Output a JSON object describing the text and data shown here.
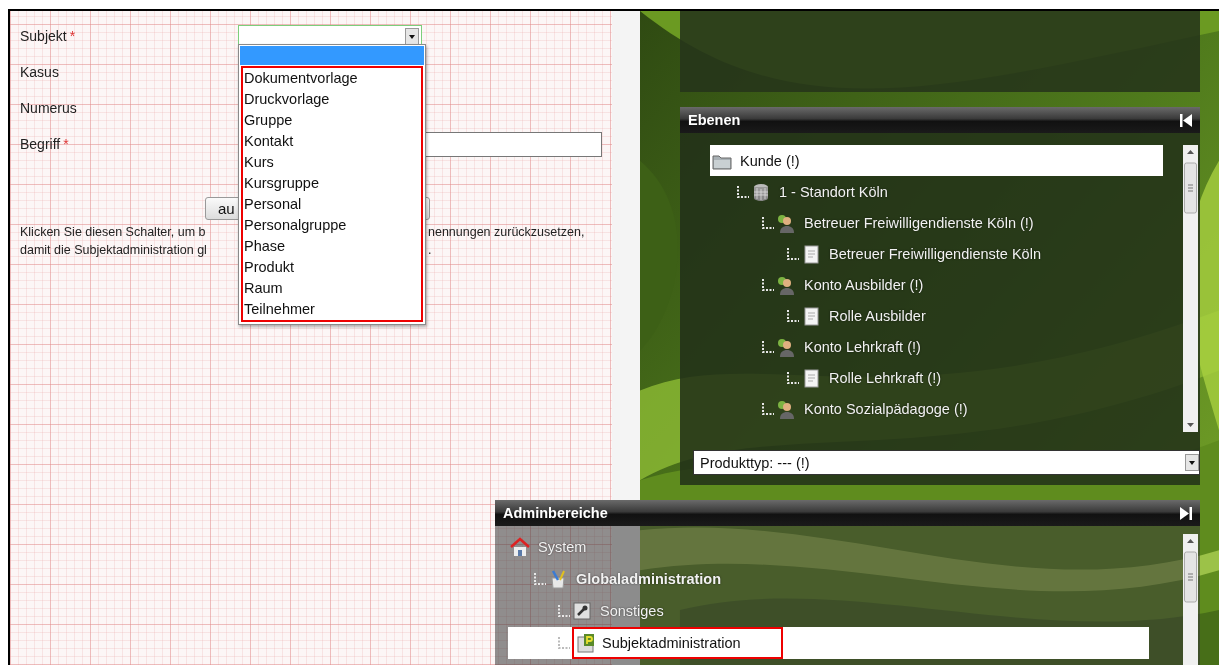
{
  "form": {
    "fields": [
      {
        "label": "Subjekt",
        "required_mark": "*",
        "kind": "select"
      },
      {
        "label": "Kasus",
        "kind": "label"
      },
      {
        "label": "Numerus",
        "kind": "label"
      },
      {
        "label": "Begriff",
        "required_mark": "*",
        "kind": "text"
      }
    ],
    "dropdown": {
      "open": true,
      "highlight_frame": true,
      "options": [
        "Dokumentvorlage",
        "Druckvorlage",
        "Gruppe",
        "Kontakt",
        "Kurs",
        "Kursgruppe",
        "Personal",
        "Personalgruppe",
        "Phase",
        "Produkt",
        "Raum",
        "Teilnehmer"
      ]
    },
    "reset_button": {
      "label": "au"
    },
    "help_text": [
      [
        "Klicken Sie diesen Schalter, um b",
        "nennungen zurückzusetzen,"
      ],
      [
        "damit die Subjektadministration gl",
        "."
      ]
    ]
  },
  "ebenen_panel": {
    "title": "Ebenen",
    "tree": [
      {
        "label": "Kunde (!)",
        "kind": "folder",
        "selected": true,
        "bold": false,
        "marked": false,
        "children": [
          {
            "label": "1 - Standort Köln",
            "kind": "site",
            "selected": false,
            "bold": false,
            "marked": false,
            "children": [
              {
                "label": "Betreuer Freiwilligendienste Köln (!)",
                "kind": "account",
                "selected": false,
                "bold": false,
                "marked": false,
                "children": [
                  {
                    "label": "Betreuer Freiwilligendienste Köln",
                    "kind": "role",
                    "selected": false,
                    "bold": false,
                    "marked": false
                  }
                ]
              },
              {
                "label": "Konto Ausbilder (!)",
                "kind": "account",
                "selected": false,
                "bold": false,
                "marked": false,
                "children": [
                  {
                    "label": "Rolle Ausbilder",
                    "kind": "role",
                    "selected": false,
                    "bold": false,
                    "marked": false
                  }
                ]
              },
              {
                "label": "Konto Lehrkraft (!)",
                "kind": "account",
                "selected": false,
                "bold": false,
                "marked": false,
                "children": [
                  {
                    "label": "Rolle Lehrkraft (!)",
                    "kind": "role",
                    "selected": false,
                    "bold": false,
                    "marked": false
                  }
                ]
              },
              {
                "label": "Konto Sozialpädagoge (!)",
                "kind": "account",
                "selected": false,
                "bold": false,
                "marked": false
              }
            ]
          }
        ]
      }
    ],
    "product_type": {
      "value": "Produkttyp: --- (!)"
    }
  },
  "admin_panel": {
    "title": "Adminbereiche",
    "tree": [
      {
        "label": "System",
        "kind": "home",
        "selected": false,
        "bold": false,
        "marked": false,
        "children": [
          {
            "label": "Globaladministration",
            "kind": "admin",
            "selected": false,
            "bold": true,
            "marked": false,
            "children": [
              {
                "label": "Sonstiges",
                "kind": "tools",
                "selected": false,
                "bold": false,
                "marked": false
              },
              {
                "label": "Subjektadministration",
                "kind": "module",
                "selected": true,
                "bold": false,
                "marked": true
              }
            ]
          }
        ]
      }
    ]
  }
}
